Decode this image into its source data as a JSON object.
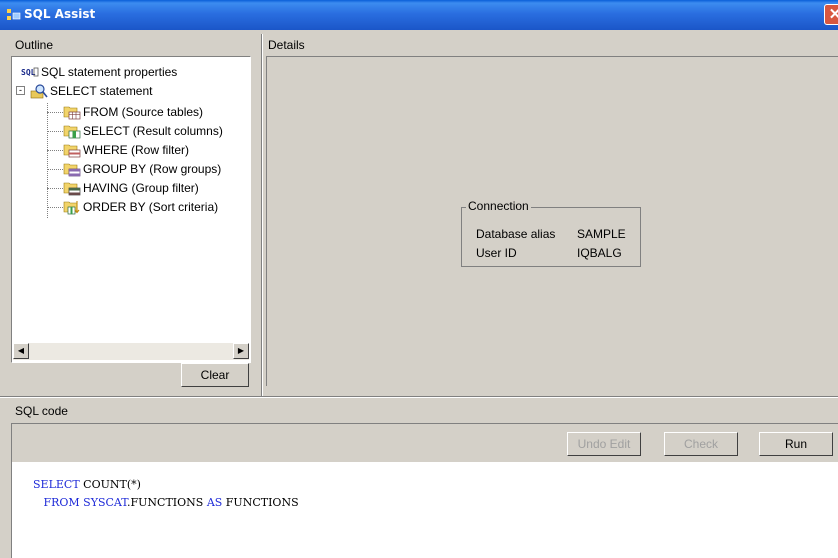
{
  "window": {
    "title": "SQL Assist",
    "close_label": "✕"
  },
  "outline": {
    "label": "Outline",
    "tree": [
      {
        "label": "SQL statement properties",
        "icon": "sql-icon"
      },
      {
        "label": "SELECT statement",
        "icon": "select-statement-icon"
      },
      {
        "label": "FROM (Source tables)",
        "icon": "folder-table-icon"
      },
      {
        "label": "SELECT (Result columns)",
        "icon": "folder-table-icon"
      },
      {
        "label": "WHERE (Row filter)",
        "icon": "folder-table-icon"
      },
      {
        "label": "GROUP BY (Row groups)",
        "icon": "folder-table-icon"
      },
      {
        "label": "HAVING (Group filter)",
        "icon": "folder-table-icon"
      },
      {
        "label": "ORDER BY (Sort criteria)",
        "icon": "folder-sort-icon"
      }
    ],
    "clear_button": "Clear"
  },
  "details": {
    "label": "Details",
    "connection": {
      "title": "Connection",
      "rows": [
        {
          "key": "Database alias",
          "value": "SAMPLE"
        },
        {
          "key": "User ID",
          "value": "IQBALG"
        }
      ]
    }
  },
  "sql": {
    "label": "SQL code",
    "buttons": {
      "undo": "Undo Edit",
      "check": "Check",
      "run": "Run"
    },
    "lines": [
      {
        "parts": [
          {
            "t": "SELECT",
            "kw": true
          },
          {
            "t": " COUNT(*)",
            "kw": false
          }
        ]
      },
      {
        "parts": [
          {
            "t": "   FROM",
            "kw": true
          },
          {
            "t": " SYSCAT",
            "kw": true
          },
          {
            "t": ".FUNCTIONS ",
            "kw": false
          },
          {
            "t": "AS",
            "kw": true
          },
          {
            "t": " FUNCTIONS",
            "kw": false
          }
        ]
      }
    ]
  },
  "colors": {
    "titlebar": "#2a6ee0",
    "keyword": "#1f2bd8",
    "window_bg": "#d4d0c8"
  }
}
